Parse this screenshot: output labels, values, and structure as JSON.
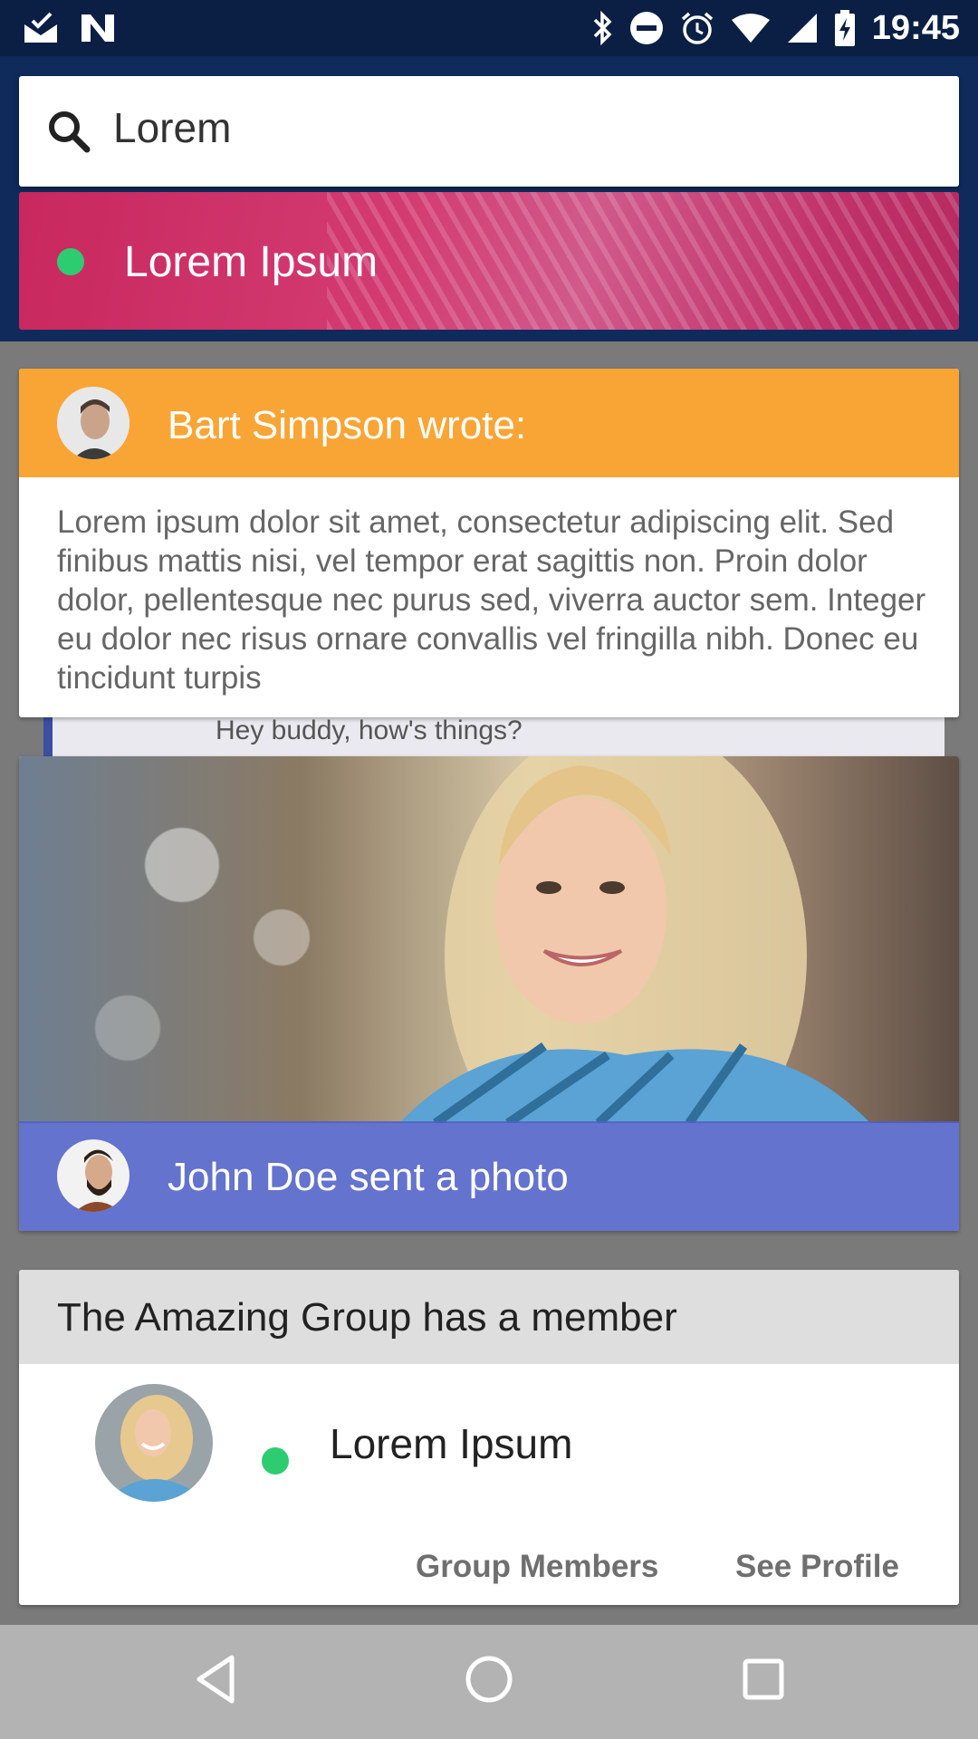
{
  "status_bar": {
    "time": "19:45",
    "left_icons": [
      "mail-check-icon",
      "n-logo-icon"
    ],
    "right_icons": [
      "bluetooth-icon",
      "do-not-disturb-icon",
      "alarm-icon",
      "wifi-icon",
      "signal-icon",
      "battery-charging-icon"
    ]
  },
  "search": {
    "value": "Lorem",
    "icon": "search-icon"
  },
  "top_card": {
    "label": "Lorem Ipsum",
    "status_color": "#2ecc71"
  },
  "bart_card": {
    "title": "Bart Simpson wrote:",
    "body": "Lorem ipsum dolor sit amet, consectetur adipiscing elit. Sed finibus mattis nisi, vel tempor erat sagittis non. Proin dolor dolor, pellentesque nec purus sed, viverra auctor sem. Integer eu dolor nec risus ornare convallis vel fringilla nibh. Donec eu tincidunt turpis",
    "header_color": "#f9a535"
  },
  "peek_card": {
    "text": "Hey buddy, how's things?"
  },
  "photo_card": {
    "title": "John Doe sent a photo",
    "band_color": "#4f60c6"
  },
  "group_card": {
    "title": "The Amazing Group has a member",
    "member_name": "Lorem Ipsum",
    "status_color": "#2ecc71",
    "buttons": [
      "Group Members",
      "See Profile"
    ]
  },
  "nav_bar": {
    "icons": [
      "back-icon",
      "home-icon",
      "recents-icon"
    ]
  }
}
